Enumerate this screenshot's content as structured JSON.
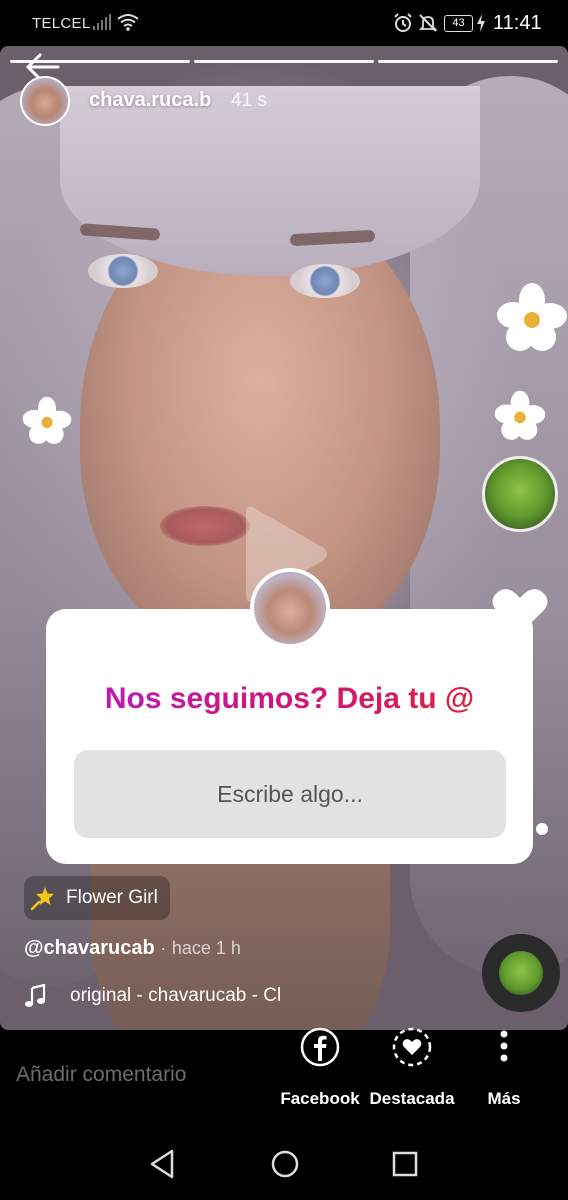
{
  "status_bar": {
    "carrier": "TELCEL",
    "battery": "43",
    "time": "11:41",
    "icons": [
      "signal-icon",
      "wifi-icon",
      "alarm-icon",
      "mute-icon",
      "battery-icon",
      "charging-icon"
    ]
  },
  "story": {
    "username": "chava.ruca.b",
    "time_ago": "41 s",
    "segments": 3
  },
  "sticker": {
    "prompt": "Nos seguimos? Deja tu @",
    "input_placeholder": "Escribe algo..."
  },
  "effect": {
    "name": "Flower Girl"
  },
  "caption": {
    "handle": "@chavarucab",
    "separator": "·",
    "time": "hace 1 h"
  },
  "music": {
    "text": "original - chavarucab - Cl"
  },
  "bottom_bar": {
    "comment_placeholder": "Añadir comentario",
    "actions": [
      {
        "label": "Facebook",
        "icon": "facebook-icon"
      },
      {
        "label": "Destacada",
        "icon": "highlight-heart-icon"
      },
      {
        "label": "Más",
        "icon": "more-icon"
      }
    ]
  },
  "navigation": [
    "back-nav-icon",
    "home-nav-icon",
    "recents-nav-icon"
  ],
  "colors": {
    "prompt_gradient": [
      "#b81cc6",
      "#d0157a",
      "#e2232c"
    ],
    "sticker_bg": "#ffffff",
    "input_bg": "#e2e2e2"
  }
}
